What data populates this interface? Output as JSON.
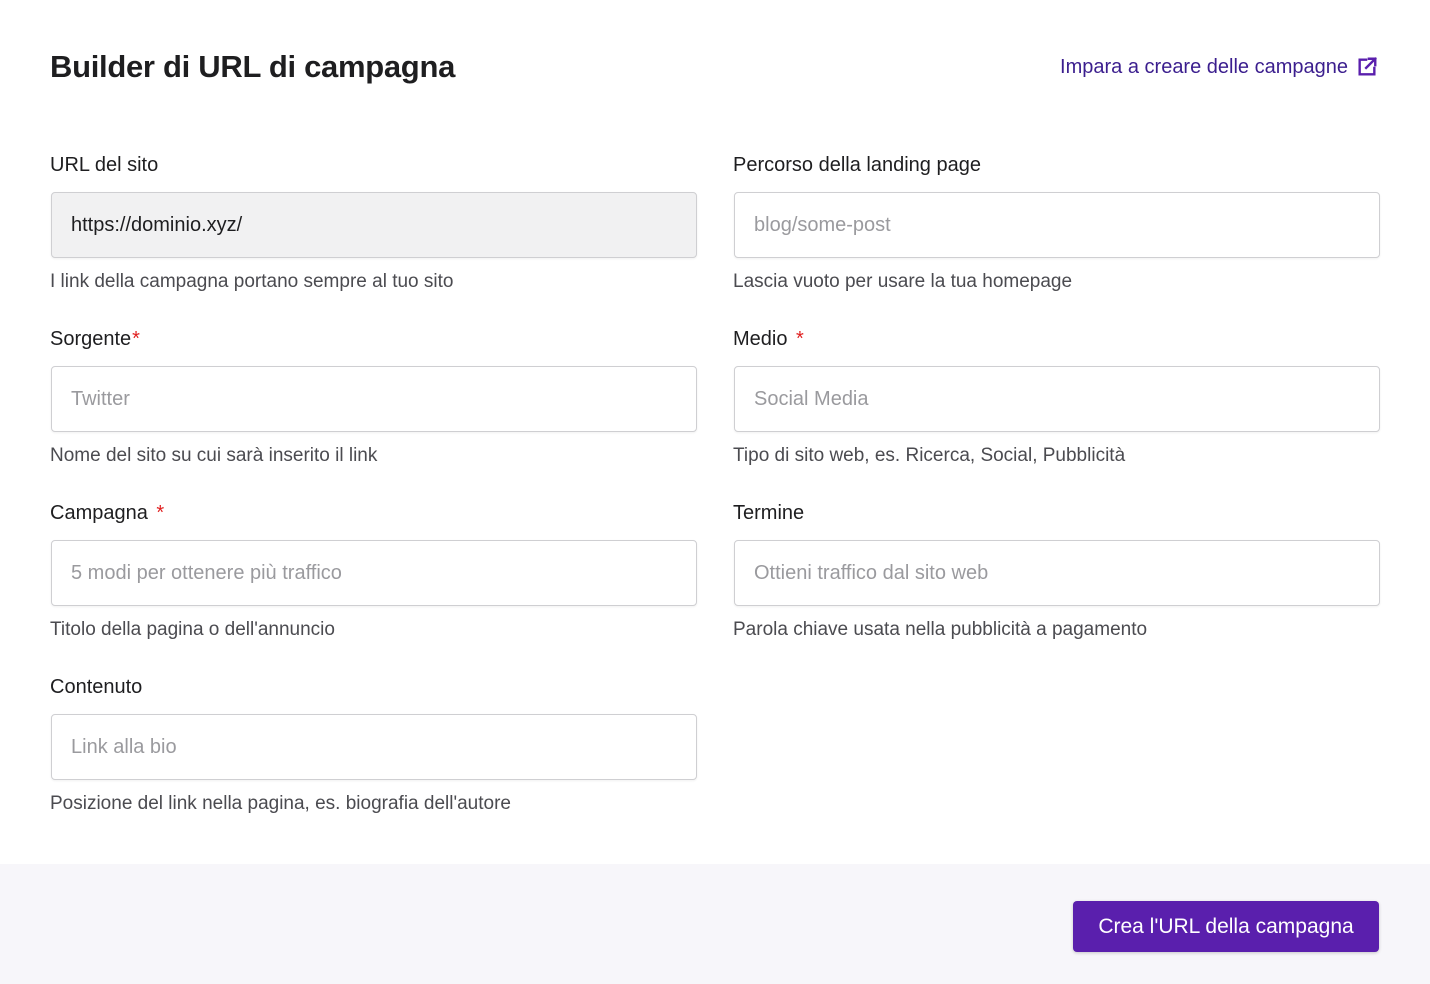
{
  "header": {
    "title": "Builder di URL di campagna",
    "learn_link": "Impara a creare delle campagne",
    "learn_link_icon": "external-link-icon",
    "link_color": "#3b1e8e"
  },
  "fields": {
    "site_url": {
      "label": "URL del sito",
      "required": false,
      "value": "https://dominio.xyz/",
      "placeholder": "",
      "help": "I link della campagna portano sempre al tuo sito",
      "readonly": true
    },
    "landing_path": {
      "label": "Percorso della landing page",
      "required": false,
      "value": "",
      "placeholder": "blog/some-post",
      "help": "Lascia vuoto per usare la tua homepage"
    },
    "source": {
      "label": "Sorgente",
      "required": true,
      "value": "",
      "placeholder": "Twitter",
      "help": "Nome del sito su cui sarà inserito il link"
    },
    "medium": {
      "label": "Medio",
      "required": true,
      "value": "",
      "placeholder": "Social Media",
      "help": "Tipo di sito web, es. Ricerca, Social, Pubblicità"
    },
    "campaign": {
      "label": "Campagna",
      "required": true,
      "value": "",
      "placeholder": "5 modi per ottenere più traffico",
      "help": "Titolo della pagina o dell'annuncio"
    },
    "term": {
      "label": "Termine",
      "required": false,
      "value": "",
      "placeholder": "Ottieni traffico dal sito web",
      "help": "Parola chiave usata nella pubblicità a pagamento"
    },
    "content": {
      "label": "Contenuto",
      "required": false,
      "value": "",
      "placeholder": "Link alla bio",
      "help": "Posizione del link nella pagina, es. biografia dell'autore"
    }
  },
  "required_marker": "*",
  "footer": {
    "submit_label": "Crea l'URL della campagna",
    "accent_color": "#5a1fad"
  }
}
